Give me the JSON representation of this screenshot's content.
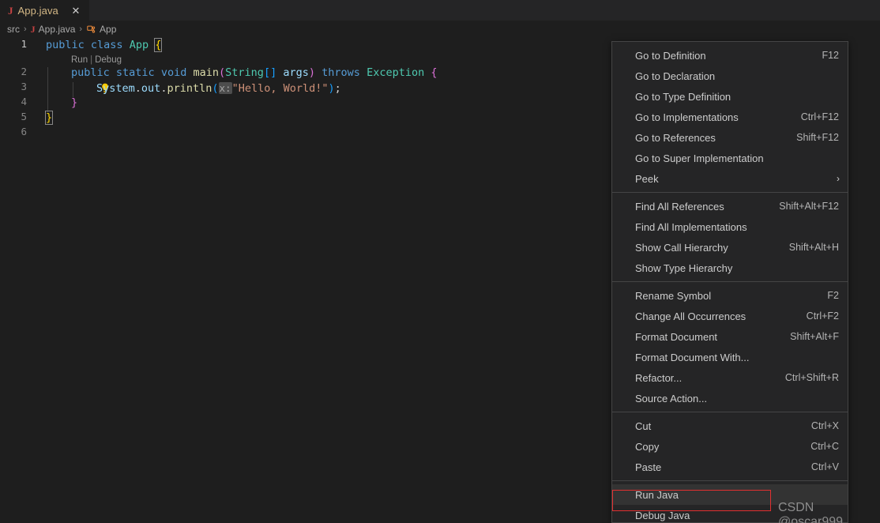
{
  "tab": {
    "icon": "java-file-icon",
    "label": "App.java",
    "close": "✕"
  },
  "breadcrumb": {
    "items": [
      {
        "label": "src",
        "icon": ""
      },
      {
        "label": "App.java",
        "icon": "java-file-icon"
      },
      {
        "label": "App",
        "icon": "class-symbol-icon"
      }
    ],
    "separator": "›"
  },
  "editor": {
    "line_numbers": [
      "1",
      "2",
      "3",
      "4",
      "5",
      "6"
    ],
    "codelens": {
      "run": "Run",
      "separator": "|",
      "debug": "Debug"
    },
    "lightbulb": "lightbulb-icon",
    "code": {
      "l1_public": "public",
      "l1_class": "class",
      "l1_app": "App",
      "l1_brace": "{",
      "l2_public": "public",
      "l2_static": "static",
      "l2_void": "void",
      "l2_main": "main",
      "l2_paren_open": "(",
      "l2_string": "String",
      "l2_brackets": "[]",
      "l2_args": "args",
      "l2_paren_close": ")",
      "l2_throws": "throws",
      "l2_exception": "Exception",
      "l2_brace": "{",
      "l3_system": "System",
      "l3_dot1": ".",
      "l3_out": "out",
      "l3_dot2": ".",
      "l3_println": "println",
      "l3_paren_open": "(",
      "l3_hint": "x:",
      "l3_string": "\"Hello, World!\"",
      "l3_paren_close": ")",
      "l3_semi": ";",
      "l4_brace": "}",
      "l5_brace": "}"
    }
  },
  "context_menu": {
    "groups": [
      {
        "items": [
          {
            "label": "Go to Definition",
            "key": "F12"
          },
          {
            "label": "Go to Declaration",
            "key": ""
          },
          {
            "label": "Go to Type Definition",
            "key": ""
          },
          {
            "label": "Go to Implementations",
            "key": "Ctrl+F12"
          },
          {
            "label": "Go to References",
            "key": "Shift+F12"
          },
          {
            "label": "Go to Super Implementation",
            "key": ""
          },
          {
            "label": "Peek",
            "key": "",
            "submenu": "›"
          }
        ]
      },
      {
        "items": [
          {
            "label": "Find All References",
            "key": "Shift+Alt+F12"
          },
          {
            "label": "Find All Implementations",
            "key": ""
          },
          {
            "label": "Show Call Hierarchy",
            "key": "Shift+Alt+H"
          },
          {
            "label": "Show Type Hierarchy",
            "key": ""
          }
        ]
      },
      {
        "items": [
          {
            "label": "Rename Symbol",
            "key": "F2"
          },
          {
            "label": "Change All Occurrences",
            "key": "Ctrl+F2"
          },
          {
            "label": "Format Document",
            "key": "Shift+Alt+F"
          },
          {
            "label": "Format Document With...",
            "key": ""
          },
          {
            "label": "Refactor...",
            "key": "Ctrl+Shift+R"
          },
          {
            "label": "Source Action...",
            "key": ""
          }
        ]
      },
      {
        "items": [
          {
            "label": "Cut",
            "key": "Ctrl+X"
          },
          {
            "label": "Copy",
            "key": "Ctrl+C"
          },
          {
            "label": "Paste",
            "key": "Ctrl+V"
          }
        ]
      },
      {
        "items": [
          {
            "label": "Run Java",
            "key": "",
            "highlighted": true
          },
          {
            "label": "Debug Java",
            "key": ""
          }
        ]
      }
    ]
  },
  "watermark": {
    "text": "CSDN @oscar999"
  },
  "colors": {
    "editor_bg": "#1e1e1e",
    "menu_bg": "#252526",
    "menu_border": "#454545",
    "highlight_red": "#e03030",
    "accent_orange": "#e8883a"
  }
}
